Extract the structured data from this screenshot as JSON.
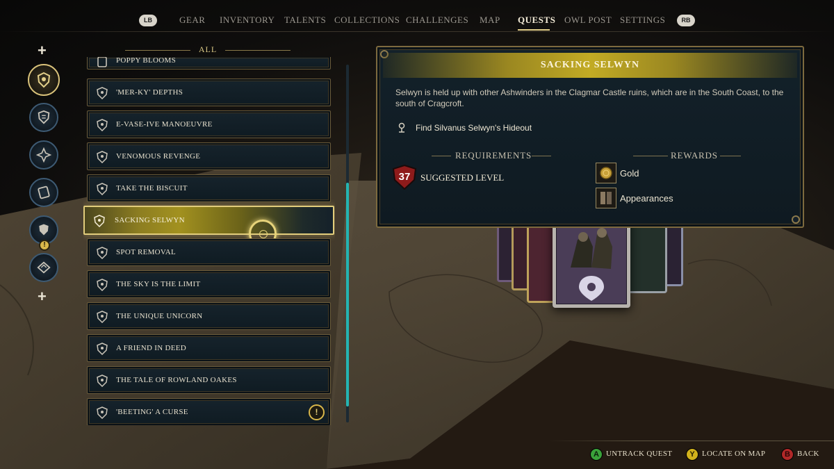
{
  "nav": {
    "left_bumper": "LB",
    "right_bumper": "RB",
    "tabs": [
      {
        "label": "GEAR"
      },
      {
        "label": "INVENTORY"
      },
      {
        "label": "TALENTS"
      },
      {
        "label": "COLLECTIONS"
      },
      {
        "label": "CHALLENGES"
      },
      {
        "label": "MAP"
      },
      {
        "label": "QUESTS"
      },
      {
        "label": "OWL POST"
      },
      {
        "label": "SETTINGS"
      }
    ],
    "active_tab": "QUESTS"
  },
  "sidebar": {
    "icons": [
      "crest-icon",
      "house-shield-icon",
      "compass-icon",
      "map-scroll-icon",
      "shield-icon",
      "hippogriff-icon"
    ],
    "alert_badge": "!"
  },
  "quest_list": {
    "filter_label": "ALL",
    "items": [
      {
        "label": "POPPY BLOOMS"
      },
      {
        "label": "'MER-KY' DEPTHS"
      },
      {
        "label": "E-VASE-IVE MANOEUVRE"
      },
      {
        "label": "VENOMOUS REVENGE"
      },
      {
        "label": "TAKE THE BISCUIT"
      },
      {
        "label": "SACKING SELWYN"
      },
      {
        "label": "SPOT REMOVAL"
      },
      {
        "label": "THE SKY IS THE LIMIT"
      },
      {
        "label": "THE UNIQUE UNICORN"
      },
      {
        "label": "A FRIEND IN DEED"
      },
      {
        "label": "THE TALE OF ROWLAND OAKES"
      },
      {
        "label": "'BEETING' A CURSE"
      }
    ],
    "selected": "SACKING SELWYN",
    "alert_badge": "!"
  },
  "details": {
    "title": "SACKING SELWYN",
    "description": "Selwyn is held up with other Ashwinders in the Clagmar Castle ruins, which are in the South Coast, to the south of Cragcroft.",
    "objective": "Find Silvanus Selwyn's Hideout",
    "requirements_heading": "REQUIREMENTS",
    "rewards_heading": "REWARDS",
    "suggested_level_number": "37",
    "suggested_level_label": "SUGGESTED LEVEL",
    "rewards": [
      {
        "label": "Gold",
        "icon": "gold-coin-icon"
      },
      {
        "label": "Appearances",
        "icon": "appearance-icon"
      }
    ]
  },
  "hints": {
    "untrack": {
      "button": "A",
      "label": "UNTRACK QUEST"
    },
    "locate": {
      "button": "Y",
      "label": "LOCATE ON MAP"
    },
    "back": {
      "button": "B",
      "label": "BACK"
    }
  },
  "colors": {
    "accent_gold": "#d9c27a",
    "scroll_teal": "#24b4b2",
    "level_red": "#8e1b1b",
    "button_a": "#3aa23a",
    "button_y": "#d2b21c",
    "button_b": "#b02828"
  }
}
